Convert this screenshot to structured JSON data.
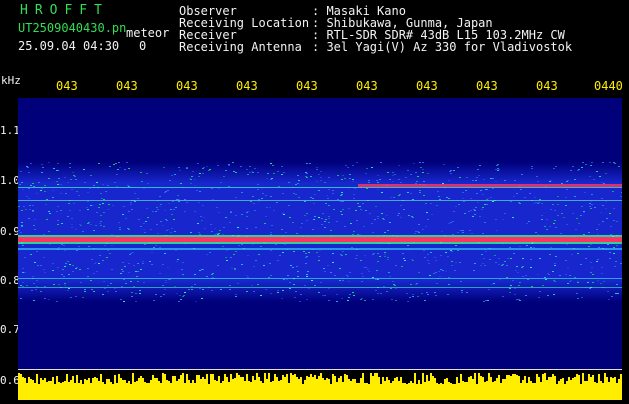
{
  "header": {
    "brand": "HROFFT",
    "file_name": "UT2509040430.pn",
    "mode": "meteor",
    "datetime": "25.09.04 04:30",
    "meteor_count": "0"
  },
  "station": {
    "observer_label": "Observer",
    "observer_value": ": Masaki Kano",
    "location_label": "Receiving Location",
    "location_value": ": Shibukawa, Gunma, Japan",
    "receiver_label": "Receiver",
    "receiver_value": ": RTL-SDR SDR# 43dB L15 103.2MHz CW",
    "antenna_label": "Receiving Antenna",
    "antenna_value": ": 3el Yagi(V) Az 330 for Vladivostok"
  },
  "axes": {
    "y_unit": "kHz",
    "y_ticks": [
      "1.1",
      "1.0",
      "0.9",
      "0.8",
      "0.7",
      "0.6"
    ],
    "x_ticks": [
      "043",
      "043",
      "043",
      "043",
      "043",
      "043",
      "043",
      "043",
      "043",
      "0440"
    ]
  },
  "colors": {
    "background": "#000000",
    "plot_background": "#00007a",
    "brand_text": "#33dd55",
    "time_ticks": "#ffee00",
    "amplitude": "#ffee00",
    "echo_band_hot": "#ff3366"
  }
}
